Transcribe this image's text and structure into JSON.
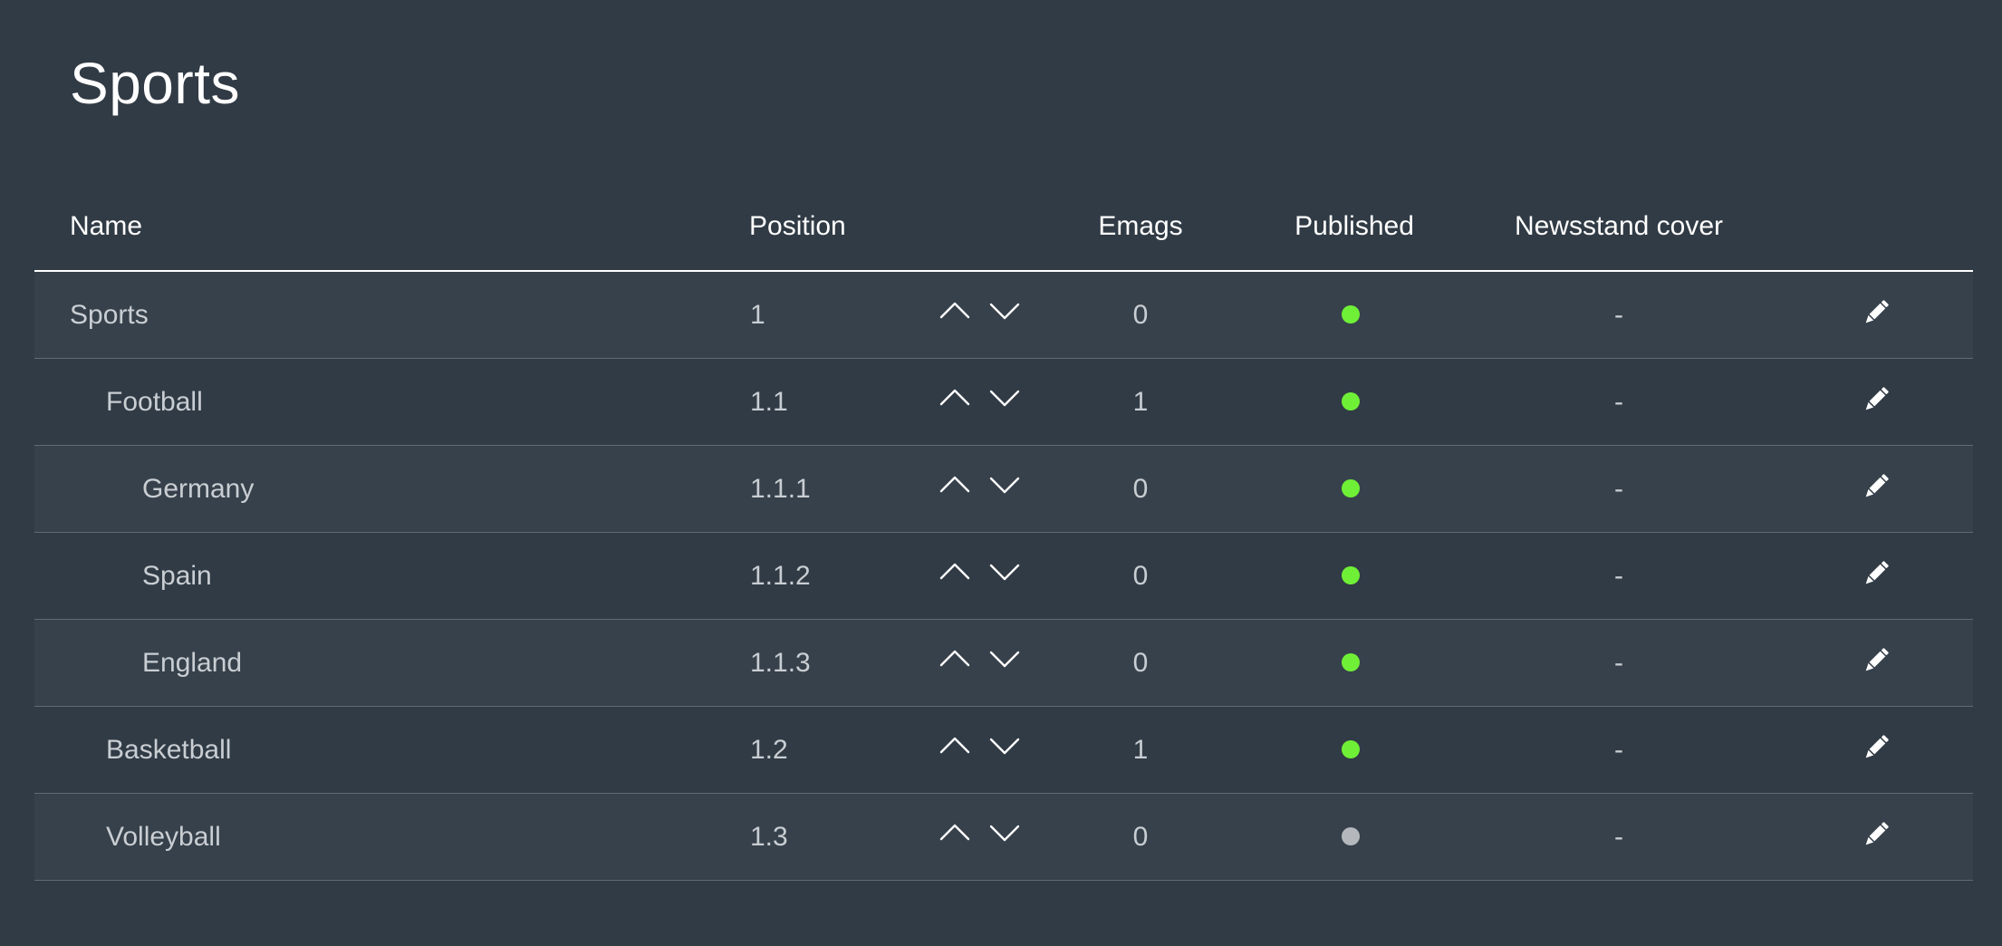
{
  "page": {
    "title": "Sports"
  },
  "table": {
    "headers": {
      "name": "Name",
      "position": "Position",
      "emags": "Emags",
      "published": "Published",
      "cover": "Newsstand cover"
    },
    "rows": [
      {
        "name": "Sports",
        "level": 0,
        "position": "1",
        "emags": "0",
        "published": true,
        "cover": "-"
      },
      {
        "name": "Football",
        "level": 1,
        "position": "1.1",
        "emags": "1",
        "published": true,
        "cover": "-"
      },
      {
        "name": "Germany",
        "level": 2,
        "position": "1.1.1",
        "emags": "0",
        "published": true,
        "cover": "-"
      },
      {
        "name": "Spain",
        "level": 2,
        "position": "1.1.2",
        "emags": "0",
        "published": true,
        "cover": "-"
      },
      {
        "name": "England",
        "level": 2,
        "position": "1.1.3",
        "emags": "0",
        "published": true,
        "cover": "-"
      },
      {
        "name": "Basketball",
        "level": 1,
        "position": "1.2",
        "emags": "1",
        "published": true,
        "cover": "-"
      },
      {
        "name": "Volleyball",
        "level": 1,
        "position": "1.3",
        "emags": "0",
        "published": false,
        "cover": "-"
      }
    ]
  },
  "icons": {
    "move_up": "chevron-up-icon",
    "move_down": "chevron-down-icon",
    "edit": "pencil-icon",
    "published_status": "status-dot-icon"
  },
  "colors": {
    "background": "#313b45",
    "row_alt": "#37414b",
    "published": "#6ff037",
    "unpublished": "#b4b8bc"
  }
}
